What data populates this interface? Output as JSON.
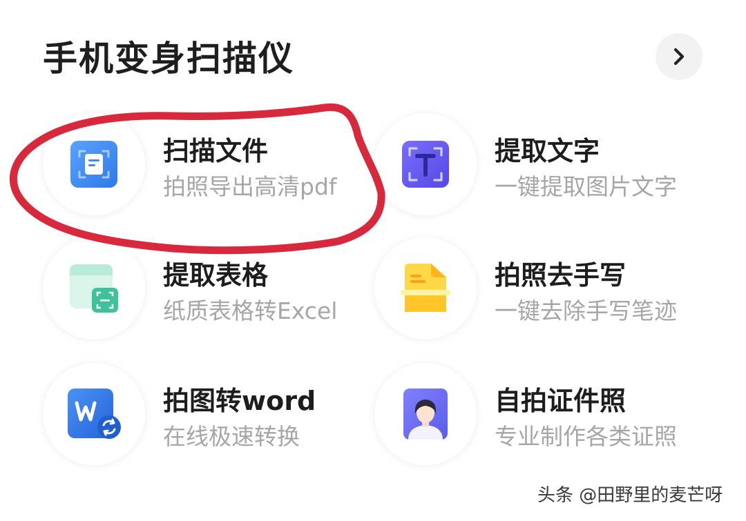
{
  "header": {
    "title": "手机变身扫描仪",
    "more_icon": "chevron-right-icon"
  },
  "tools": [
    {
      "title": "扫描文件",
      "subtitle": "拍照导出高清pdf",
      "icon": "scan-document-icon",
      "accent": "#3d8af0"
    },
    {
      "title": "提取文字",
      "subtitle": "一键提取图片文字",
      "icon": "text-extract-icon",
      "accent": "#6a5cf0"
    },
    {
      "title": "提取表格",
      "subtitle": "纸质表格转Excel",
      "icon": "table-extract-icon",
      "accent": "#3fc29a"
    },
    {
      "title": "拍照去手写",
      "subtitle": "一键去除手写笔迹",
      "icon": "remove-handwriting-icon",
      "accent": "#ffc62a"
    },
    {
      "title": "拍图转word",
      "subtitle": "在线极速转换",
      "icon": "word-convert-icon",
      "accent": "#2f78e8"
    },
    {
      "title": "自拍证件照",
      "subtitle": "专业制作各类证照",
      "icon": "id-photo-icon",
      "accent": "#6d6ff2"
    }
  ],
  "annotation": {
    "color": "#d7283c",
    "marks": "扫描文件"
  },
  "watermark": "头条 @田野里的麦芒呀"
}
